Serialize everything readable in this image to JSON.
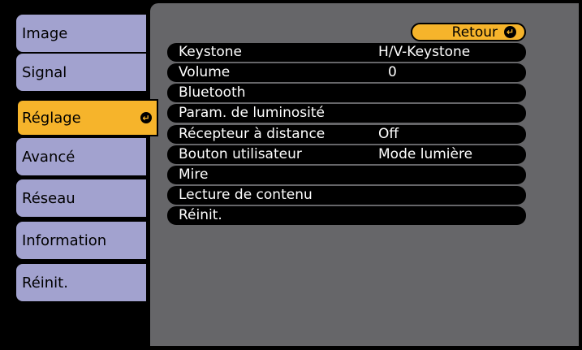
{
  "sidebar": {
    "items": [
      {
        "label": "Image"
      },
      {
        "label": "Signal"
      },
      {
        "label": "Réglage"
      },
      {
        "label": "Avancé"
      },
      {
        "label": "Réseau"
      },
      {
        "label": "Information"
      },
      {
        "label": "Réinit."
      }
    ],
    "selected_index": 2
  },
  "header": {
    "back_label": "Retour"
  },
  "settings": [
    {
      "name": "Keystone",
      "value": "H/V-Keystone"
    },
    {
      "name": "Volume",
      "value": "0"
    },
    {
      "name": "Bluetooth",
      "value": ""
    },
    {
      "name": "Param. de luminosité",
      "value": ""
    },
    {
      "name": "Récepteur à distance",
      "value": "Off"
    },
    {
      "name": "Bouton utilisateur",
      "value": "Mode lumière"
    },
    {
      "name": "Mire",
      "value": ""
    },
    {
      "name": "Lecture de contenu",
      "value": ""
    },
    {
      "name": "Réinit.",
      "value": ""
    }
  ],
  "colors": {
    "menu_tab": "#a2a2cf",
    "selected": "#f6b42b",
    "panel": "#666669",
    "row": "#000000"
  },
  "icons": {
    "enter": "enter-icon"
  }
}
